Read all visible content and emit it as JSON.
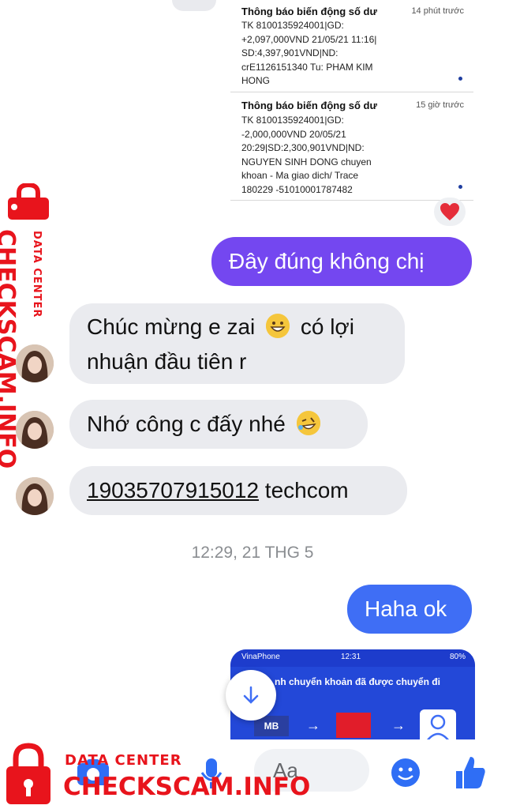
{
  "notifications": [
    {
      "title": "Thông báo biến động số dư",
      "time": "14 phút trước",
      "body": "TK 8100135924001|GD:\n+2,097,000VND 21/05/21 11:16|\nSD:4,397,901VND|ND:\ncrE1126151340 Tu: PHAM KIM\nHONG"
    },
    {
      "title": "Thông báo biến động số dư",
      "time": "15 giờ trước",
      "body": "TK 8100135924001|GD:\n-2,000,000VND 20/05/21\n20:29|SD:2,300,901VND|ND:\nNGUYEN SINH DONG chuyen\nkhoan - Ma giao dich/ Trace\n180229 -51010001787482"
    }
  ],
  "messages": [
    {
      "direction": "out",
      "text": "Đây đúng không chị"
    },
    {
      "direction": "in",
      "line1": "Chúc mừng e zai",
      "line1_after": "có lợi",
      "line2": "nhuận đầu tiên r",
      "emoji": "grinning-face"
    },
    {
      "direction": "in",
      "text": "Nhớ công c đấy nhé",
      "emoji": "rolling-laughing-face"
    },
    {
      "direction": "in",
      "account": "19035707915012",
      "text": "techcom"
    }
  ],
  "timestamp": "12:29, 21 THG 5",
  "reply": {
    "text": "Haha ok"
  },
  "shared_image": {
    "carrier": "VinaPhone",
    "clock": "12:31",
    "battery": "80%",
    "caption": "nh chuyển khoản đã được chuyển đi",
    "bank_from": "MB"
  },
  "composer": {
    "placeholder": "Aa"
  },
  "watermark": {
    "line1": "DATA CENTER",
    "line2": "CHECKSCAM.INFO"
  },
  "colors": {
    "outgoing_purple": "#7447f0",
    "outgoing_blue": "#3f6ef5",
    "incoming_bg": "#eaebef",
    "icon_blue": "#2f6ef5",
    "watermark_red": "#e8141c"
  }
}
